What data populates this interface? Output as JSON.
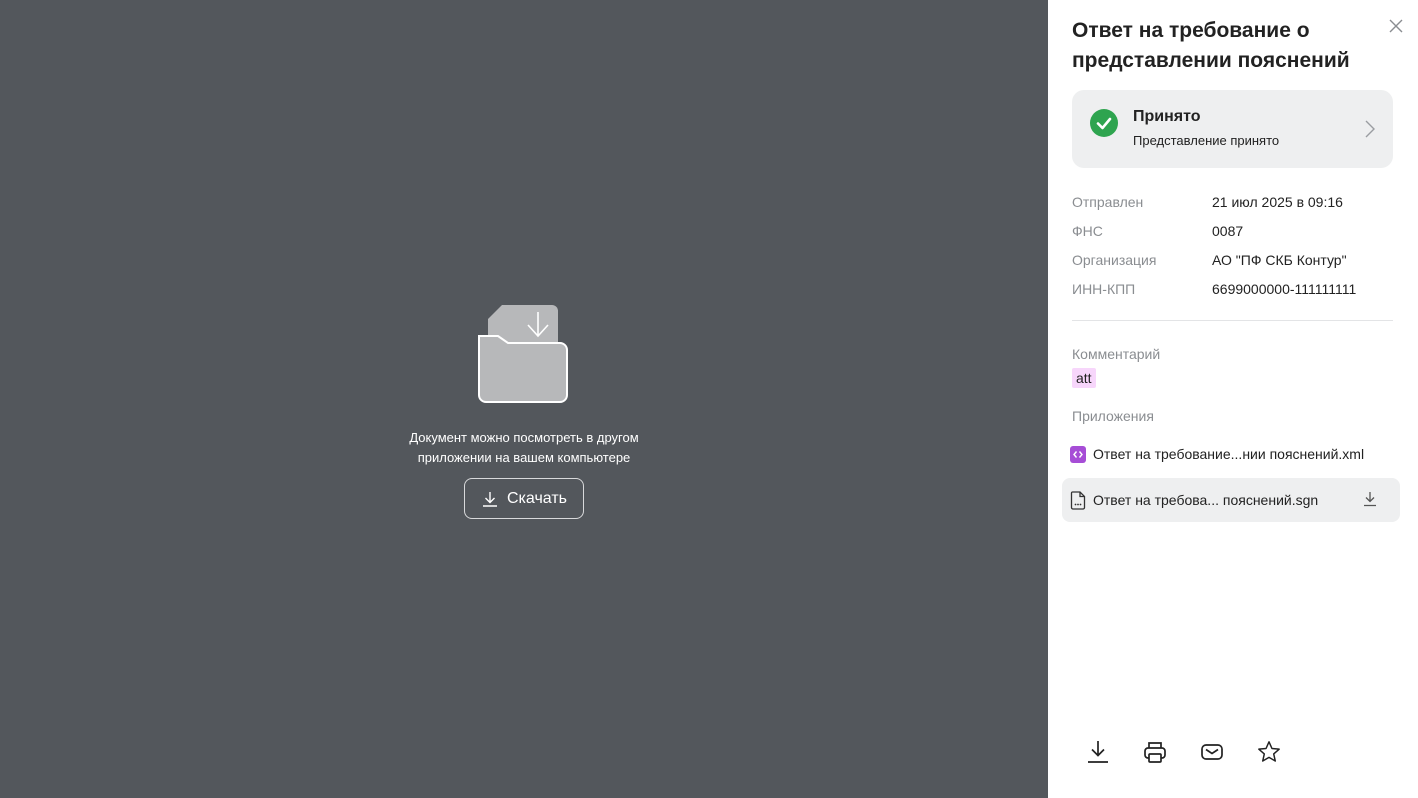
{
  "preview": {
    "message_line1": "Документ можно посмотреть в другом",
    "message_line2": "приложении на вашем компьютере",
    "download_label": "Скачать",
    "background": "#53575c"
  },
  "panel": {
    "title": "Ответ на требование о представлении пояснений",
    "status": {
      "title": "Принято",
      "subtitle": "Представление принято",
      "color": "#2ea44f"
    },
    "info": [
      {
        "key": "Отправлен",
        "value": "21 июл 2025 в 09:16"
      },
      {
        "key": "ФНС",
        "value": "0087"
      },
      {
        "key": "Организация",
        "value": "АО \"ПФ СКБ Контур\""
      },
      {
        "key": "ИНН-КПП",
        "value": "6699000000-111111111"
      }
    ],
    "comment_label": "Комментарий",
    "comment_value": "att",
    "attachments_label": "Приложения",
    "attachments": [
      {
        "name": "Ответ на требование...нии пояснений.xml",
        "icon": "xml-file-icon"
      },
      {
        "name": "Ответ на требова... пояснений.sgn",
        "icon": "document-icon"
      }
    ],
    "toolbar": [
      "download-icon",
      "print-icon",
      "mail-icon",
      "star-icon"
    ]
  }
}
